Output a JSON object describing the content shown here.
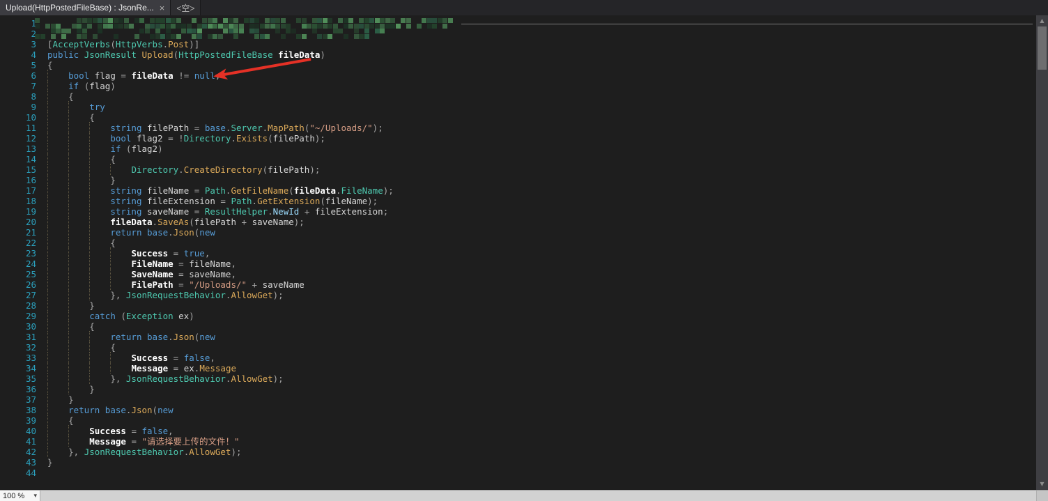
{
  "window": {
    "tab1": {
      "title": "Upload(HttpPostedFileBase) : JsonRe...",
      "close": "×"
    },
    "tab2": {
      "title": "<空>"
    }
  },
  "icons": {
    "close": "×",
    "dropdown": "▾",
    "scroll_up": "▲",
    "scroll_down": "▼"
  },
  "statusbar": {
    "zoom": "100 %"
  },
  "colors": {
    "bg": "#1e1e1e",
    "kw": "#569cd6",
    "type": "#4ec9b0",
    "method": "#dcaa5a",
    "str": "#d69d85",
    "param": "#ffffff",
    "local": "#d6d6d6",
    "punct": "#a8a8a8",
    "pblue": "#9cdcfe",
    "lineno": "#2ba0bd",
    "guide": "#5f5742",
    "arrow": "#e53126"
  },
  "censor": {
    "greens": [
      "#1d3526",
      "#24422c",
      "#2e5637",
      "#3a6b44",
      "#478253",
      "#55975f",
      "#2c5e46"
    ]
  },
  "editor": {
    "lines": [
      {
        "n": 1,
        "i": 0,
        "t": [],
        "censored": true
      },
      {
        "n": 2,
        "i": 0,
        "t": [],
        "censored": true
      },
      {
        "n": 3,
        "i": 0,
        "t": [
          [
            "o",
            "["
          ],
          [
            "t",
            "AcceptVerbs"
          ],
          [
            "o",
            "("
          ],
          [
            "t",
            "HttpVerbs"
          ],
          [
            "o",
            "."
          ],
          [
            "m",
            "Post"
          ],
          [
            "o",
            ")]"
          ]
        ]
      },
      {
        "n": 4,
        "i": 0,
        "t": [
          [
            "k",
            "public "
          ],
          [
            "t",
            "JsonResult "
          ],
          [
            "m",
            "Upload"
          ],
          [
            "o",
            "("
          ],
          [
            "t",
            "HttpPostedFileBase "
          ],
          [
            "p",
            "fileData"
          ],
          [
            "o",
            ")"
          ]
        ]
      },
      {
        "n": 5,
        "i": 0,
        "t": [
          [
            "o",
            "{"
          ]
        ]
      },
      {
        "n": 6,
        "i": 4,
        "t": [
          [
            "k",
            "bool "
          ],
          [
            "v",
            "flag "
          ],
          [
            "o",
            "= "
          ],
          [
            "p",
            "fileData "
          ],
          [
            "o",
            "!= "
          ],
          [
            "k",
            "null"
          ],
          [
            "o",
            ";"
          ]
        ]
      },
      {
        "n": 7,
        "i": 4,
        "t": [
          [
            "k",
            "if "
          ],
          [
            "o",
            "("
          ],
          [
            "v",
            "flag"
          ],
          [
            "o",
            ")"
          ]
        ]
      },
      {
        "n": 8,
        "i": 4,
        "t": [
          [
            "o",
            "{"
          ]
        ]
      },
      {
        "n": 9,
        "i": 8,
        "t": [
          [
            "k",
            "try"
          ]
        ]
      },
      {
        "n": 10,
        "i": 8,
        "t": [
          [
            "o",
            "{"
          ]
        ]
      },
      {
        "n": 11,
        "i": 12,
        "t": [
          [
            "k",
            "string "
          ],
          [
            "v",
            "filePath "
          ],
          [
            "o",
            "= "
          ],
          [
            "k",
            "base"
          ],
          [
            "o",
            "."
          ],
          [
            "t",
            "Server"
          ],
          [
            "o",
            "."
          ],
          [
            "m",
            "MapPath"
          ],
          [
            "o",
            "("
          ],
          [
            "s",
            "\"~/Uploads/\""
          ],
          [
            "o",
            ");"
          ]
        ]
      },
      {
        "n": 12,
        "i": 12,
        "t": [
          [
            "k",
            "bool "
          ],
          [
            "v",
            "flag2 "
          ],
          [
            "o",
            "= !"
          ],
          [
            "t",
            "Directory"
          ],
          [
            "o",
            "."
          ],
          [
            "m",
            "Exists"
          ],
          [
            "o",
            "("
          ],
          [
            "v",
            "filePath"
          ],
          [
            "o",
            ");"
          ]
        ]
      },
      {
        "n": 13,
        "i": 12,
        "t": [
          [
            "k",
            "if "
          ],
          [
            "o",
            "("
          ],
          [
            "v",
            "flag2"
          ],
          [
            "o",
            ")"
          ]
        ]
      },
      {
        "n": 14,
        "i": 12,
        "t": [
          [
            "o",
            "{"
          ]
        ]
      },
      {
        "n": 15,
        "i": 16,
        "t": [
          [
            "t",
            "Directory"
          ],
          [
            "o",
            "."
          ],
          [
            "m",
            "CreateDirectory"
          ],
          [
            "o",
            "("
          ],
          [
            "v",
            "filePath"
          ],
          [
            "o",
            ");"
          ]
        ]
      },
      {
        "n": 16,
        "i": 12,
        "t": [
          [
            "o",
            "}"
          ]
        ]
      },
      {
        "n": 17,
        "i": 12,
        "t": [
          [
            "k",
            "string "
          ],
          [
            "v",
            "fileName "
          ],
          [
            "o",
            "= "
          ],
          [
            "t",
            "Path"
          ],
          [
            "o",
            "."
          ],
          [
            "m",
            "GetFileName"
          ],
          [
            "o",
            "("
          ],
          [
            "p",
            "fileData"
          ],
          [
            "o",
            "."
          ],
          [
            "t",
            "FileName"
          ],
          [
            "o",
            ");"
          ]
        ]
      },
      {
        "n": 18,
        "i": 12,
        "t": [
          [
            "k",
            "string "
          ],
          [
            "v",
            "fileExtension "
          ],
          [
            "o",
            "= "
          ],
          [
            "t",
            "Path"
          ],
          [
            "o",
            "."
          ],
          [
            "m",
            "GetExtension"
          ],
          [
            "o",
            "("
          ],
          [
            "v",
            "fileName"
          ],
          [
            "o",
            ");"
          ]
        ]
      },
      {
        "n": 19,
        "i": 12,
        "t": [
          [
            "k",
            "string "
          ],
          [
            "v",
            "saveName "
          ],
          [
            "o",
            "= "
          ],
          [
            "t",
            "ResultHelper"
          ],
          [
            "o",
            "."
          ],
          [
            "pb",
            "NewId"
          ],
          [
            "o",
            " + "
          ],
          [
            "v",
            "fileExtension"
          ],
          [
            "o",
            ";"
          ]
        ]
      },
      {
        "n": 20,
        "i": 12,
        "t": [
          [
            "p",
            "fileData"
          ],
          [
            "o",
            "."
          ],
          [
            "m",
            "SaveAs"
          ],
          [
            "o",
            "("
          ],
          [
            "v",
            "filePath"
          ],
          [
            "o",
            " + "
          ],
          [
            "v",
            "saveName"
          ],
          [
            "o",
            ");"
          ]
        ]
      },
      {
        "n": 21,
        "i": 12,
        "t": [
          [
            "k",
            "return "
          ],
          [
            "k",
            "base"
          ],
          [
            "o",
            "."
          ],
          [
            "m",
            "Json"
          ],
          [
            "o",
            "("
          ],
          [
            "k",
            "new"
          ]
        ]
      },
      {
        "n": 22,
        "i": 12,
        "t": [
          [
            "o",
            "{"
          ]
        ]
      },
      {
        "n": 23,
        "i": 16,
        "t": [
          [
            "p",
            "Success "
          ],
          [
            "o",
            "= "
          ],
          [
            "k",
            "true"
          ],
          [
            "o",
            ","
          ]
        ]
      },
      {
        "n": 24,
        "i": 16,
        "t": [
          [
            "p",
            "FileName "
          ],
          [
            "o",
            "= "
          ],
          [
            "v",
            "fileName"
          ],
          [
            "o",
            ","
          ]
        ]
      },
      {
        "n": 25,
        "i": 16,
        "t": [
          [
            "p",
            "SaveName "
          ],
          [
            "o",
            "= "
          ],
          [
            "v",
            "saveName"
          ],
          [
            "o",
            ","
          ]
        ]
      },
      {
        "n": 26,
        "i": 16,
        "t": [
          [
            "p",
            "FilePath "
          ],
          [
            "o",
            "= "
          ],
          [
            "s",
            "\"/Uploads/\""
          ],
          [
            "o",
            " + "
          ],
          [
            "v",
            "saveName"
          ]
        ]
      },
      {
        "n": 27,
        "i": 12,
        "t": [
          [
            "o",
            "}, "
          ],
          [
            "t",
            "JsonRequestBehavior"
          ],
          [
            "o",
            "."
          ],
          [
            "m",
            "AllowGet"
          ],
          [
            "o",
            ");"
          ]
        ]
      },
      {
        "n": 28,
        "i": 8,
        "t": [
          [
            "o",
            "}"
          ]
        ]
      },
      {
        "n": 29,
        "i": 8,
        "t": [
          [
            "k",
            "catch "
          ],
          [
            "o",
            "("
          ],
          [
            "t",
            "Exception "
          ],
          [
            "v",
            "ex"
          ],
          [
            "o",
            ")"
          ]
        ]
      },
      {
        "n": 30,
        "i": 8,
        "t": [
          [
            "o",
            "{"
          ]
        ]
      },
      {
        "n": 31,
        "i": 12,
        "t": [
          [
            "k",
            "return "
          ],
          [
            "k",
            "base"
          ],
          [
            "o",
            "."
          ],
          [
            "m",
            "Json"
          ],
          [
            "o",
            "("
          ],
          [
            "k",
            "new"
          ]
        ]
      },
      {
        "n": 32,
        "i": 12,
        "t": [
          [
            "o",
            "{"
          ]
        ]
      },
      {
        "n": 33,
        "i": 16,
        "t": [
          [
            "p",
            "Success "
          ],
          [
            "o",
            "= "
          ],
          [
            "k",
            "false"
          ],
          [
            "o",
            ","
          ]
        ]
      },
      {
        "n": 34,
        "i": 16,
        "t": [
          [
            "p",
            "Message "
          ],
          [
            "o",
            "= "
          ],
          [
            "v",
            "ex"
          ],
          [
            "o",
            "."
          ],
          [
            "m",
            "Message"
          ]
        ]
      },
      {
        "n": 35,
        "i": 12,
        "t": [
          [
            "o",
            "}, "
          ],
          [
            "t",
            "JsonRequestBehavior"
          ],
          [
            "o",
            "."
          ],
          [
            "m",
            "AllowGet"
          ],
          [
            "o",
            ");"
          ]
        ]
      },
      {
        "n": 36,
        "i": 8,
        "t": [
          [
            "o",
            "}"
          ]
        ]
      },
      {
        "n": 37,
        "i": 4,
        "t": [
          [
            "o",
            "}"
          ]
        ]
      },
      {
        "n": 38,
        "i": 4,
        "t": [
          [
            "k",
            "return "
          ],
          [
            "k",
            "base"
          ],
          [
            "o",
            "."
          ],
          [
            "m",
            "Json"
          ],
          [
            "o",
            "("
          ],
          [
            "k",
            "new"
          ]
        ]
      },
      {
        "n": 39,
        "i": 4,
        "t": [
          [
            "o",
            "{"
          ]
        ]
      },
      {
        "n": 40,
        "i": 8,
        "t": [
          [
            "p",
            "Success "
          ],
          [
            "o",
            "= "
          ],
          [
            "k",
            "false"
          ],
          [
            "o",
            ","
          ]
        ]
      },
      {
        "n": 41,
        "i": 8,
        "t": [
          [
            "p",
            "Message "
          ],
          [
            "o",
            "= "
          ],
          [
            "s",
            "\"请选择要上传的文件！\""
          ]
        ]
      },
      {
        "n": 42,
        "i": 4,
        "t": [
          [
            "o",
            "}, "
          ],
          [
            "t",
            "JsonRequestBehavior"
          ],
          [
            "o",
            "."
          ],
          [
            "m",
            "AllowGet"
          ],
          [
            "o",
            ");"
          ]
        ]
      },
      {
        "n": 43,
        "i": 0,
        "t": [
          [
            "o",
            "}"
          ]
        ]
      },
      {
        "n": 44,
        "i": 0,
        "t": []
      }
    ]
  }
}
